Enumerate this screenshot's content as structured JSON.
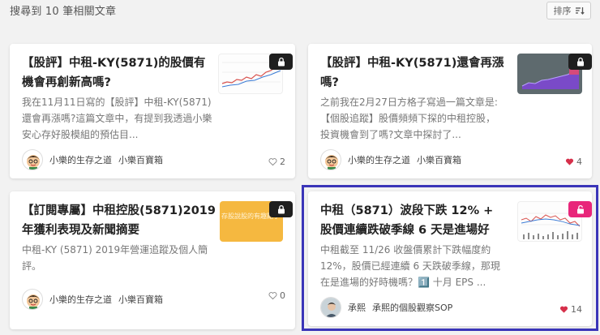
{
  "header": {
    "result_text": "搜尋到 10 筆相關文章",
    "sort_label": "排序",
    "sort_icon": "sort-icon"
  },
  "colors": {
    "lock_dark": "#1f1f1f",
    "lock_unlocked": "#e8267a",
    "heart_liked": "#d62f4a",
    "highlight_border": "#3b35b8"
  },
  "cards": [
    {
      "title": "【股評】中租-KY(5871)的股價有機會再創新高嗎?",
      "excerpt": "我在11月11日寫的【股評】中租-KY(5871)還會再漲嗎?這篇文章中，有提到我透過小樂安心存好股模組的預估目...",
      "author": "小樂的生存之道",
      "column": "小樂百寶箱",
      "likes": "2",
      "lock_icon": "lock-icon",
      "liked": false
    },
    {
      "title": "【股評】中租-KY(5871)還會再漲嗎?",
      "excerpt": "之前我在2月27日方格子寫過一篇文章是:【個股追蹤】股價頻頻下探的中租控股，投資機會到了嗎?文章中探討了...",
      "author": "小樂的生存之道",
      "column": "小樂百寶箱",
      "likes": "4",
      "lock_icon": "lock-icon",
      "liked": true
    },
    {
      "title": "【訂閱專屬】中租控股(5871)2019年獲利表現及新聞摘要",
      "excerpt": "中租-KY (5871) 2019年營運追蹤及個人簡評。",
      "thumb_text": "存股說股的有趣點子",
      "author": "小樂的生存之道",
      "column": "小樂百寶箱",
      "likes": "0",
      "lock_icon": "lock-icon",
      "liked": false
    },
    {
      "title": "中租（5871）波段下跌 12% + 股價連續跌破季線 6 天是進場好時...",
      "excerpt": "中租截至 11/26 收盤價累計下跌幅度約 12%，股價已經連續 6 天跌破季線，那現在是進場的好時機嗎？1️⃣ 十月 EPS ...",
      "author": "承熙",
      "column": "承熙的個股觀察SOP",
      "likes": "14",
      "lock_icon": "unlock-icon",
      "liked": true
    }
  ]
}
